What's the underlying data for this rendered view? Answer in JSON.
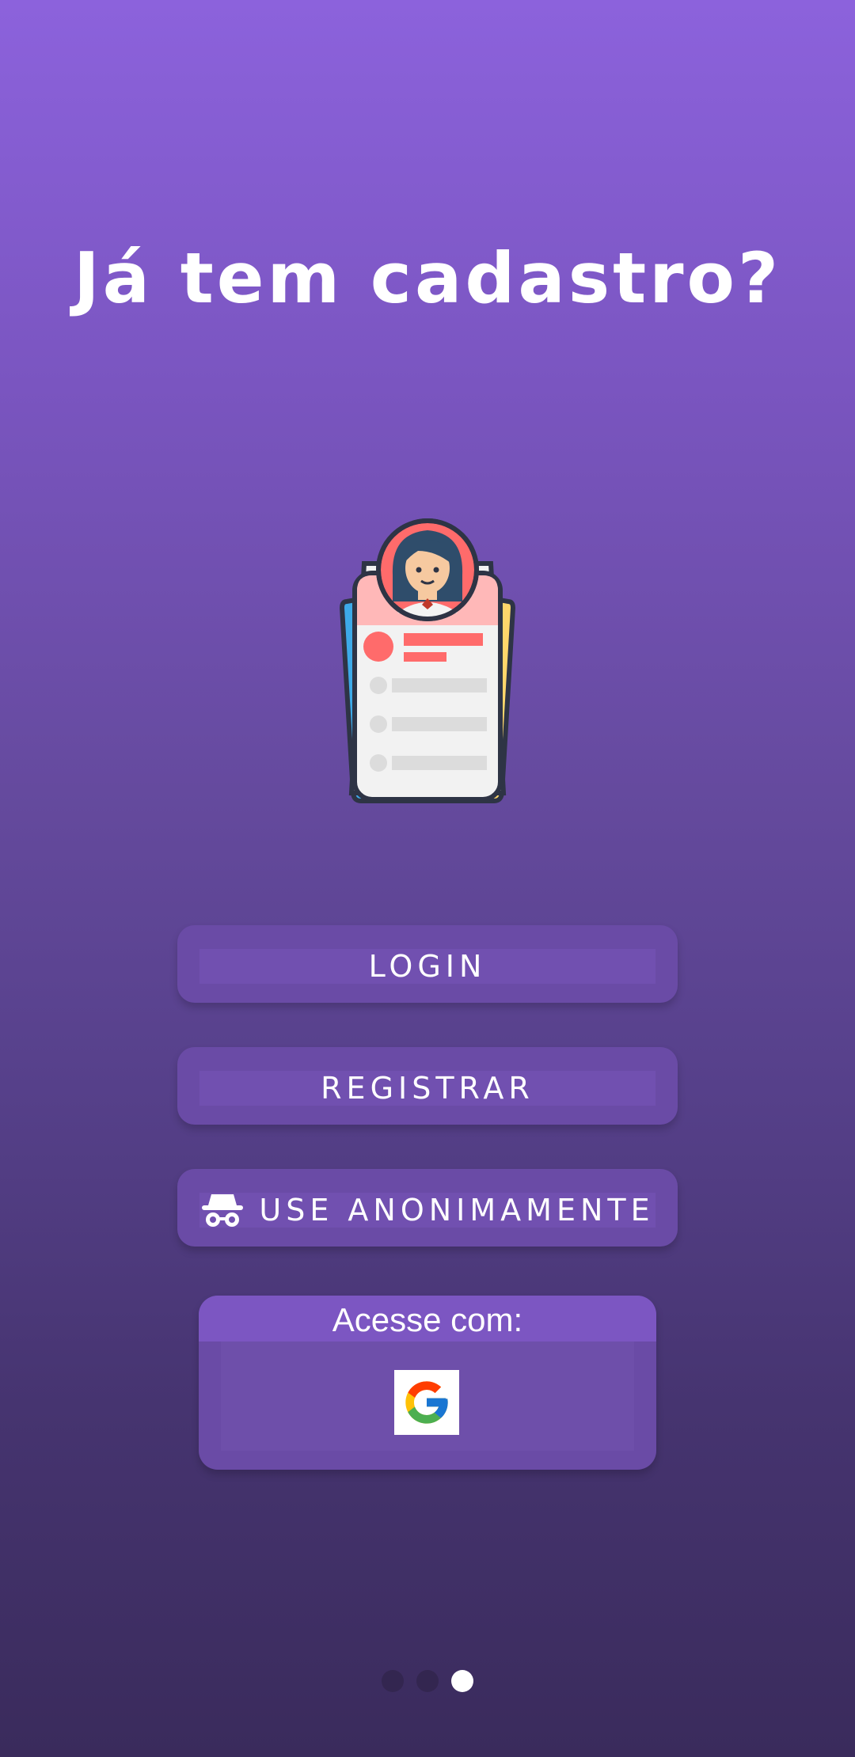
{
  "header": {
    "title": "Já tem cadastro?"
  },
  "illustration": {
    "icon": "profile-card-icon"
  },
  "buttons": {
    "login_label": "LOGIN",
    "register_label": "REGISTRAR",
    "anonymous_label": "USE ANONIMAMENTE",
    "anonymous_icon": "incognito-icon"
  },
  "social": {
    "header": "Acesse com:",
    "google_icon": "google-icon"
  },
  "pager": {
    "total": 3,
    "active_index": 2
  },
  "colors": {
    "background_top": "#8c62dc",
    "background_bottom": "#3a2b5c",
    "button": "#6a4ba6",
    "card_header": "#7c56c2"
  }
}
